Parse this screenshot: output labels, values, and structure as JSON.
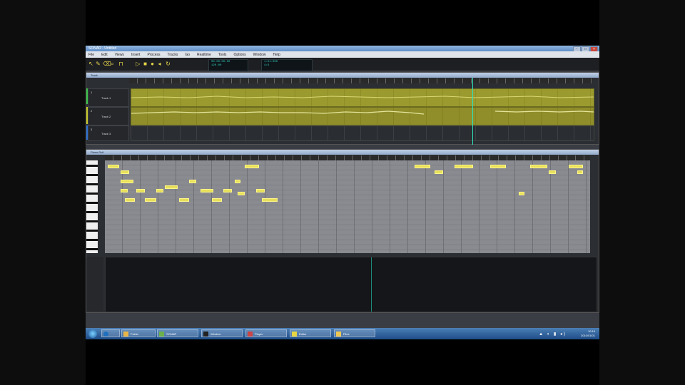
{
  "window": {
    "title": "SONAR - Untitled",
    "controls": [
      "-",
      "□",
      "×"
    ]
  },
  "menu": [
    "File",
    "Edit",
    "Views",
    "Insert",
    "Process",
    "Tracks",
    "Go",
    "Realtime",
    "Tools",
    "Options",
    "Window",
    "Help"
  ],
  "toolbar": {
    "tools": [
      "select-icon",
      "draw-icon",
      "erase-icon",
      "zoom-icon",
      "scrub-icon",
      "snap-icon",
      "play-icon",
      "stop-icon",
      "record-icon",
      "rewind-icon",
      "loop-icon"
    ],
    "time_display": "00:00:00:00",
    "tempo_display": "120.00",
    "meter_display": "4/4",
    "position_display": "1:01:000"
  },
  "track_view": {
    "title": "Track",
    "tracks": [
      {
        "name": "Track 1",
        "number": "1"
      },
      {
        "name": "Track 2",
        "number": "2"
      },
      {
        "name": "Track 3",
        "number": "3"
      }
    ]
  },
  "piano_roll": {
    "title": "Piano Roll"
  },
  "taskbar": {
    "start_label": "Start",
    "tasks": [
      {
        "label": "Folder",
        "icon": "folder-icon",
        "color": "#e8b646"
      },
      {
        "label": "SONAR",
        "icon": "sonar-icon",
        "color": "#6ab04c"
      },
      {
        "label": "Window",
        "icon": "app-icon",
        "color": "#222222"
      },
      {
        "label": "Player",
        "icon": "media-icon",
        "color": "#c44"
      },
      {
        "label": "Editor",
        "icon": "editor-icon",
        "color": "#e8d640"
      },
      {
        "label": "Files",
        "icon": "folder-icon",
        "color": "#f0c850"
      }
    ],
    "time": "10:15",
    "date": "2010/01/01"
  },
  "colors": {
    "accent": "#e8e05a",
    "lcd_text": "#35d0c0",
    "playhead": "#2fe0b8"
  }
}
